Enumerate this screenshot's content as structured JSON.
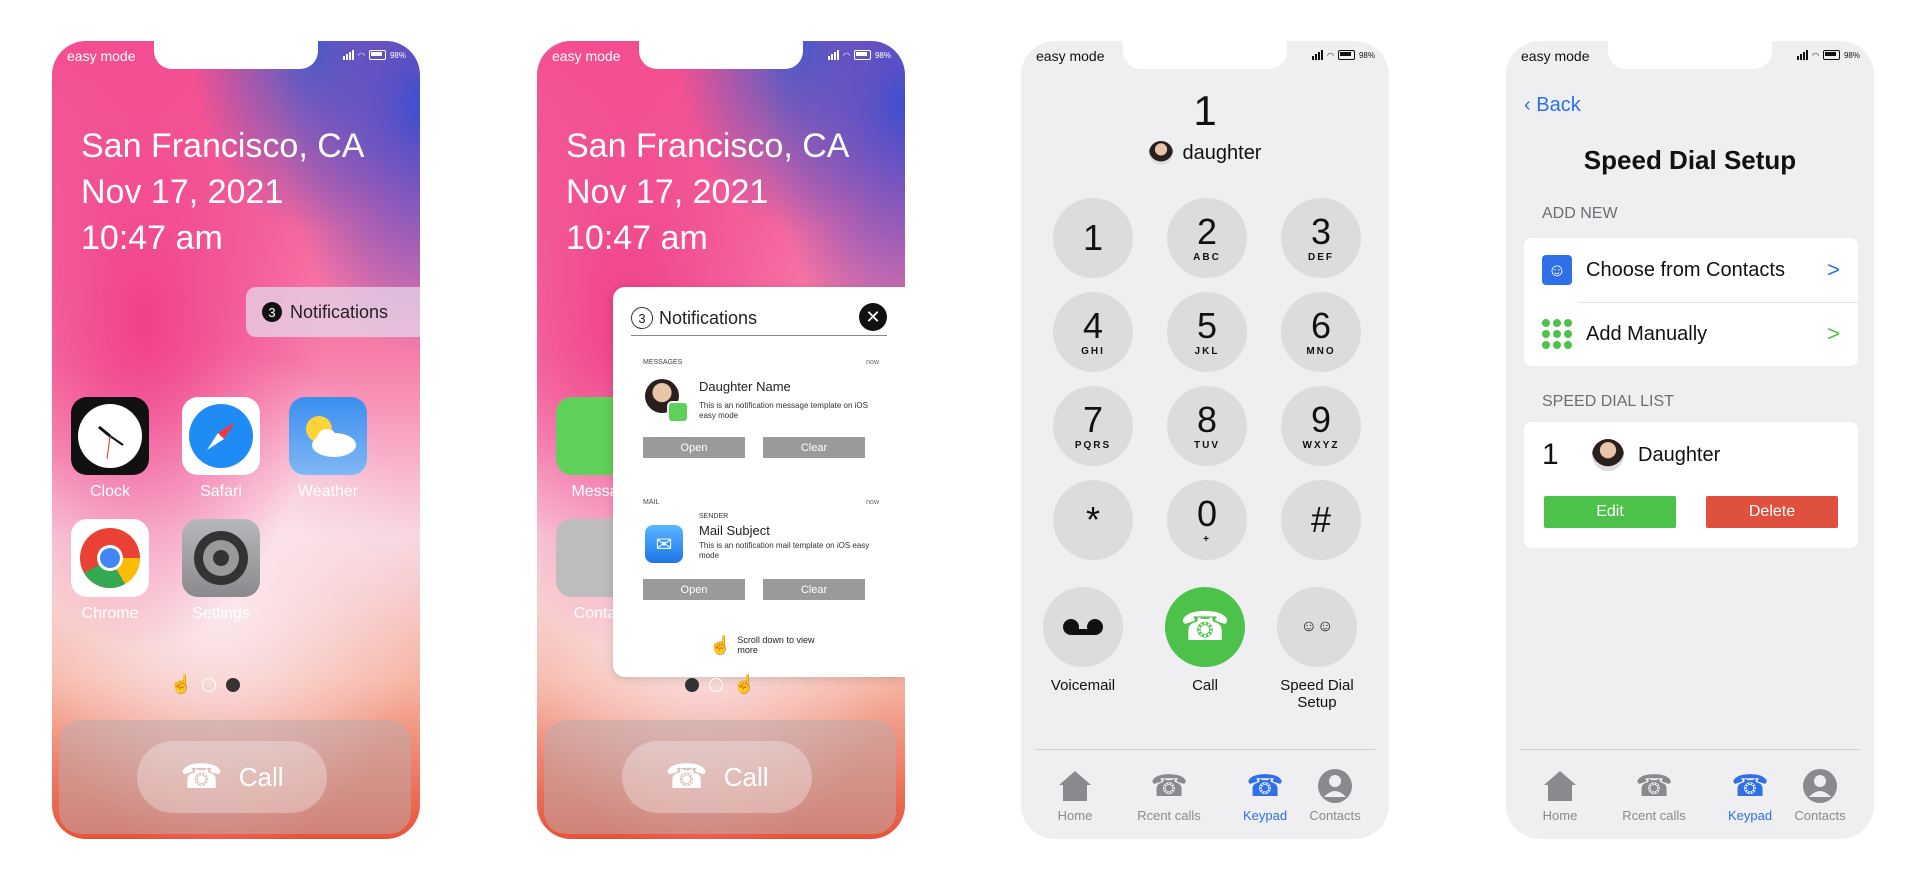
{
  "status": {
    "mode": "easy mode",
    "battery": "98%"
  },
  "lock": {
    "city": "San Francisco, CA",
    "date": "Nov 17, 2021",
    "time": "10:47 am",
    "notif_count": "3",
    "notif_label": "Notifications",
    "call_label": "Call"
  },
  "apps": [
    {
      "label": "Clock"
    },
    {
      "label": "Safari"
    },
    {
      "label": "Weather"
    },
    {
      "label": "Chrome"
    },
    {
      "label": "Settings"
    },
    {
      "label": "Messages",
      "visible": "Messa"
    },
    {
      "label": "Contacts",
      "visible": "Conta"
    }
  ],
  "notif_panel": {
    "count": "3",
    "title": "Notifications",
    "message": {
      "category": "MESSAGES",
      "time": "now",
      "title": "Daughter Name",
      "body": "This is an notification message template on iOS easy mode",
      "open": "Open",
      "clear": "Clear"
    },
    "mail": {
      "category": "MAIL",
      "time": "now",
      "sender": "SENDER",
      "title": "Mail Subject",
      "body": "This is an notification mail template on iOS easy mode",
      "open": "Open",
      "clear": "Clear"
    },
    "scroll_hint": "Scroll down to view more"
  },
  "keypad": {
    "number": "1",
    "contact": "daughter",
    "keys": [
      {
        "digit": "1",
        "letters": ""
      },
      {
        "digit": "2",
        "letters": "ABC"
      },
      {
        "digit": "3",
        "letters": "DEF"
      },
      {
        "digit": "4",
        "letters": "GHI"
      },
      {
        "digit": "5",
        "letters": "JKL"
      },
      {
        "digit": "6",
        "letters": "MNO"
      },
      {
        "digit": "7",
        "letters": "PQRS"
      },
      {
        "digit": "8",
        "letters": "TUV"
      },
      {
        "digit": "9",
        "letters": "WXYZ"
      },
      {
        "digit": "*",
        "letters": ""
      },
      {
        "digit": "0",
        "letters": "+"
      },
      {
        "digit": "#",
        "letters": ""
      }
    ],
    "voicemail": "Voicemail",
    "call": "Call",
    "speed_dial": "Speed Dial Setup",
    "call_color": "#4cc24a"
  },
  "tabs": [
    {
      "label": "Home"
    },
    {
      "label": "Rcent calls"
    },
    {
      "label": "Keypad"
    },
    {
      "label": "Contacts"
    }
  ],
  "speed_dial_setup": {
    "back": "Back",
    "title": "Speed Dial Setup",
    "add_new": "ADD NEW",
    "choose_contacts": "Choose from Contacts",
    "add_manually": "Add Manually",
    "list_header": "SPEED DIAL LIST",
    "entry_number": "1",
    "entry_name": "Daughter",
    "edit": "Edit",
    "delete": "Delete",
    "edit_color": "#4cc24a",
    "delete_color": "#e0503e",
    "accent": "#2f6fe8"
  }
}
